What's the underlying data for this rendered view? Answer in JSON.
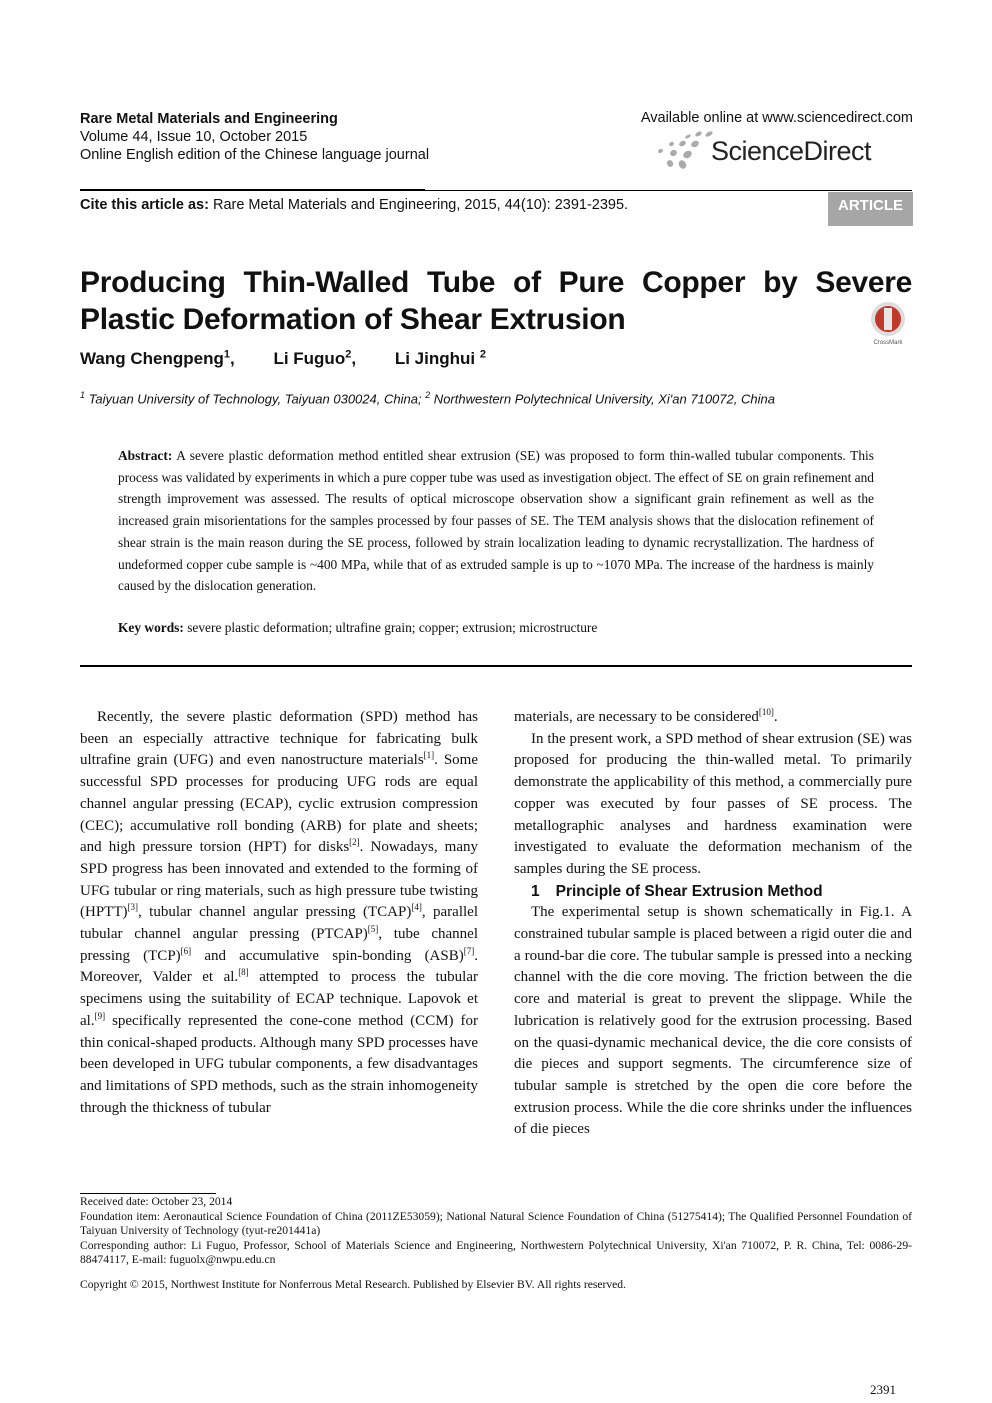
{
  "header": {
    "journal": "Rare Metal Materials and Engineering",
    "volume": "Volume 44, Issue 10, October 2015",
    "edition": "Online English edition of the Chinese language journal",
    "available": "Available online at www.sciencedirect.com",
    "logo_text": "ScienceDirect",
    "cite_label": "Cite this article as:",
    "cite_text": " Rare Metal Materials and Engineering, 2015, 44(10): 2391-2395.",
    "badge": "ARTICLE"
  },
  "title_line1": "Producing Thin-Walled Tube of Pure Copper by Severe",
  "title_line2": "Plastic Deformation of Shear Extrusion",
  "crossmark_text": "CrossMark",
  "authors": [
    {
      "name": "Wang Chengpeng",
      "sup": "1",
      "sep": ","
    },
    {
      "name": "Li Fuguo",
      "sup": "2",
      "sep": ","
    },
    {
      "name": "Li Jinghui",
      "sup": "2",
      "sep": ""
    }
  ],
  "affiliations": [
    {
      "sup": "1",
      "text": " Taiyuan University of Technology, Taiyuan 030024, China; "
    },
    {
      "sup": "2",
      "text": " Northwestern Polytechnical University, Xi'an 710072, China"
    }
  ],
  "abstract": {
    "label": "Abstract:",
    "text": " A severe plastic deformation method entitled shear extrusion (SE) was proposed to form thin-walled tubular components. This process was validated by experiments in which a pure copper tube was used as investigation object. The effect of SE on grain refinement and strength improvement was assessed. The results of optical microscope observation show a significant grain refinement as well as the increased grain misorientations for the samples processed by four passes of SE. The TEM analysis shows that the dislocation refinement of shear strain is the main reason during the SE process, followed by strain localization leading to dynamic recrystallization. The hardness of undeformed copper cube sample is ~400 MPa, while that of as extruded sample is up to ~1070 MPa. The increase of the hardness is mainly caused by the dislocation generation."
  },
  "keywords": {
    "label": "Key words:",
    "text": " severe plastic deformation; ultrafine grain; copper; extrusion; microstructure"
  },
  "body_left": [
    [
      {
        "t": "Recently, the severe plastic deformation (SPD) method has been an especially attractive technique for fabricating bulk ultrafine grain (UFG) and even nanostructure materials"
      },
      {
        "s": "[1]"
      },
      {
        "t": ". Some successful SPD processes for producing UFG rods are equal channel angular pressing (ECAP), cyclic extrusion compression (CEC); accumulative roll bonding (ARB) for plate and sheets; and high pressure torsion (HPT) for disks"
      },
      {
        "s": "[2]"
      },
      {
        "t": ". Nowadays, many SPD progress has been innovated and extended to the forming of UFG tubular or ring materials, such as high pressure tube twisting (HPTT)"
      },
      {
        "s": "[3]"
      },
      {
        "t": ", tubular channel angular pressing (TCAP)"
      },
      {
        "s": "[4]"
      },
      {
        "t": ", parallel tubular channel angular pressing (PTCAP)"
      },
      {
        "s": "[5]"
      },
      {
        "t": ", tube channel pressing (TCP)"
      },
      {
        "s": "[6]"
      },
      {
        "t": " and accumulative spin-bonding (ASB)"
      },
      {
        "s": "[7]"
      },
      {
        "t": ". Moreover, Valder et al."
      },
      {
        "s": "[8]"
      },
      {
        "t": " attempted to process the tubular specimens using the suitability of ECAP technique. Lapovok et al."
      },
      {
        "s": "[9]"
      },
      {
        "t": " specifically represented the cone-cone method (CCM) for thin conical-shaped products. Although many SPD processes have been developed in UFG tubular components, a few disadvantages and limitations of SPD methods, such as the strain inhomogeneity through the thickness of tubular"
      }
    ]
  ],
  "body_right": {
    "p1": [
      {
        "t": "materials, are necessary to be considered"
      },
      {
        "s": "[10]"
      },
      {
        "t": "."
      }
    ],
    "p2": "In the present work, a SPD method of shear extrusion (SE) was proposed for producing the thin-walled metal. To primarily demonstrate the applicability of this method, a commercially pure copper was executed by four passes of SE process. The metallographic analyses and hardness examination were investigated to evaluate the deformation mechanism of the samples during the SE process.",
    "section_number": "1",
    "section_title": "Principle of Shear Extrusion Method",
    "p3": "The experimental setup is shown schematically in Fig.1. A constrained tubular sample is placed between a rigid outer die and a round-bar die core. The tubular sample is pressed into a necking channel with the die core moving. The friction between the die core and material is great to prevent the slippage. While the lubrication is relatively good for the extrusion processing. Based on the quasi-dynamic mechanical device, the die core consists of die pieces and support segments. The circumference size of tubular sample is stretched by the open die core before the extrusion process. While the die core shrinks under the influences of die pieces"
  },
  "footnotes": {
    "received": "Received date: October 23, 2014",
    "foundation": "Foundation item: Aeronautical Science Foundation of China (2011ZE53059); National Natural Science Foundation of China (51275414); The Qualified Personnel Foundation of Taiyuan University of Technology (tyut-re201441a)",
    "corresponding": "Corresponding author: Li Fuguo, Professor, School of Materials Science and Engineering, Northwestern Polytechnical University, Xi'an 710072, P. R. China, Tel: 0086-29-88474117, E-mail: fuguolx@nwpu.edu.cn",
    "copyright": "Copyright © 2015, Northwest Institute for Nonferrous Metal Research. Published by Elsevier BV. All rights reserved."
  },
  "page_number": "2391",
  "colors": {
    "badge": "#a6a6a6",
    "crossmark_red": "#c0392b"
  }
}
